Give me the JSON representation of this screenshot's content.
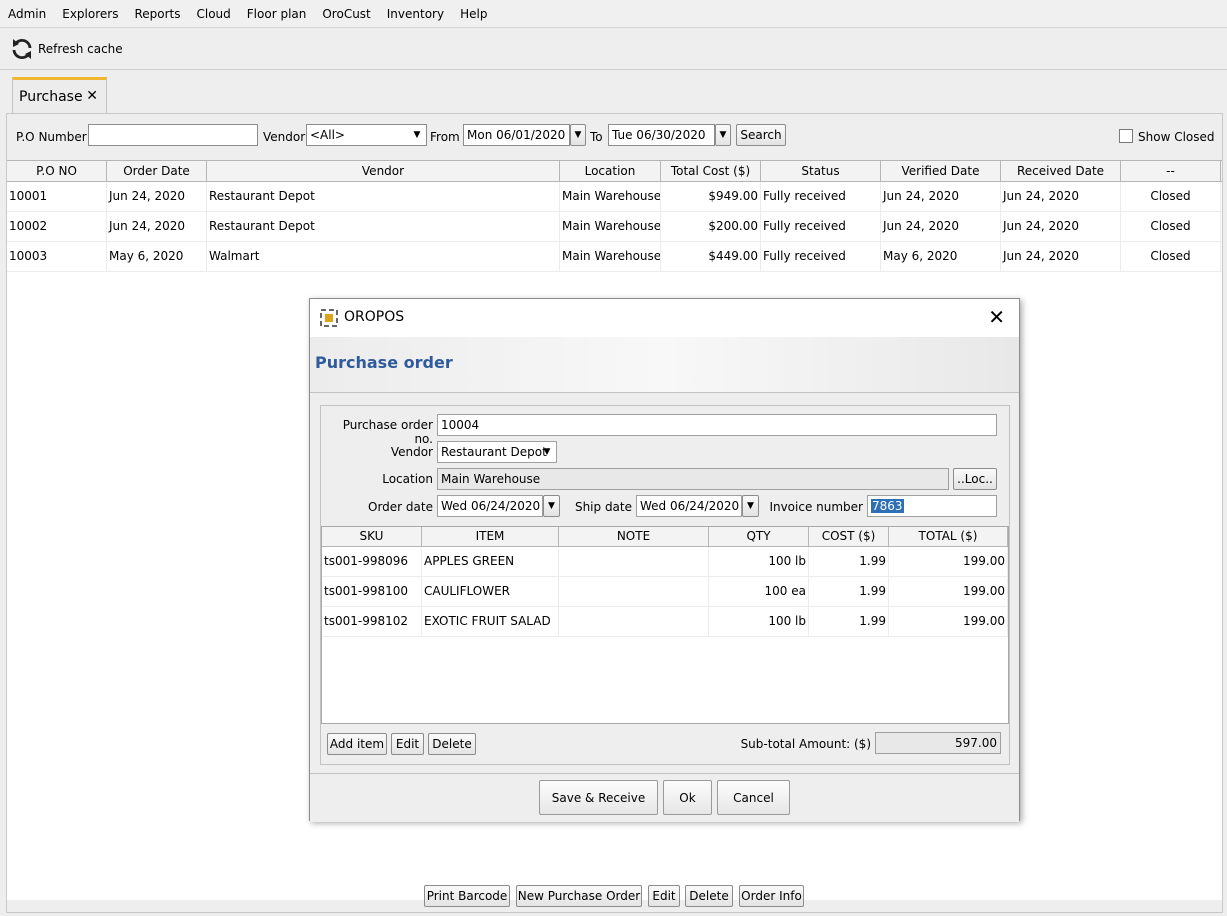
{
  "menu": [
    "Admin",
    "Explorers",
    "Reports",
    "Cloud",
    "Floor plan",
    "OroCust",
    "Inventory",
    "Help"
  ],
  "toolbar": {
    "refresh_label": "Refresh cache"
  },
  "tab": {
    "label": "Purchase",
    "close": "✕"
  },
  "filters": {
    "po_number_label": "P.O Number",
    "po_number_value": "",
    "vendor_label": "Vendor",
    "vendor_value": "<All>",
    "from_label": "From",
    "from_value": "Mon 06/01/2020",
    "to_label": "To",
    "to_value": "Tue 06/30/2020",
    "search_label": "Search",
    "show_closed_label": "Show Closed",
    "show_closed_checked": false
  },
  "po_table": {
    "columns": [
      "P.O NO",
      "Order Date",
      "Vendor",
      "Location",
      "Total Cost ($)",
      "Status",
      "Verified Date",
      "Received Date",
      "--"
    ],
    "rows": [
      [
        "10001",
        "Jun 24, 2020",
        "Restaurant Depot",
        "Main Warehouse",
        "$949.00",
        "Fully received",
        "Jun 24, 2020",
        "Jun 24, 2020",
        "Closed"
      ],
      [
        "10002",
        "Jun 24, 2020",
        "Restaurant Depot",
        "Main Warehouse",
        "$200.00",
        "Fully received",
        "Jun 24, 2020",
        "Jun 24, 2020",
        "Closed"
      ],
      [
        "10003",
        "May 6, 2020",
        "Walmart",
        "Main Warehouse",
        "$449.00",
        "Fully received",
        "May 6, 2020",
        "Jun 24, 2020",
        "Closed"
      ]
    ]
  },
  "bottom_buttons": [
    "Print Barcode",
    "New Purchase Order",
    "Edit",
    "Delete",
    "Order Info"
  ],
  "dialog": {
    "app_title": "OROPOS",
    "header": "Purchase order",
    "po_no_label": "Purchase order no.",
    "po_no_value": "10004",
    "vendor_label": "Vendor",
    "vendor_value": "Restaurant Depot",
    "location_label": "Location",
    "location_value": "Main Warehouse",
    "location_button": "..Loc..",
    "order_date_label": "Order date",
    "order_date_value": "Wed 06/24/2020",
    "ship_date_label": "Ship date",
    "ship_date_value": "Wed 06/24/2020",
    "invoice_label": "Invoice number",
    "invoice_value": "7863",
    "item_columns": [
      "SKU",
      "ITEM",
      "NOTE",
      "QTY",
      "COST ($)",
      "TOTAL ($)"
    ],
    "items": [
      [
        "ts001-998096",
        "APPLES GREEN",
        "",
        "100 lb",
        "1.99",
        "199.00"
      ],
      [
        "ts001-998100",
        "CAULIFLOWER",
        "",
        "100 ea",
        "1.99",
        "199.00"
      ],
      [
        "ts001-998102",
        "EXOTIC FRUIT SALAD",
        "",
        "100 lb",
        "1.99",
        "199.00"
      ]
    ],
    "add_item": "Add item",
    "edit": "Edit",
    "delete": "Delete",
    "subtotal_label": "Sub-total Amount: ($)",
    "subtotal_value": "597.00",
    "save_receive": "Save & Receive",
    "ok": "Ok",
    "cancel": "Cancel"
  }
}
